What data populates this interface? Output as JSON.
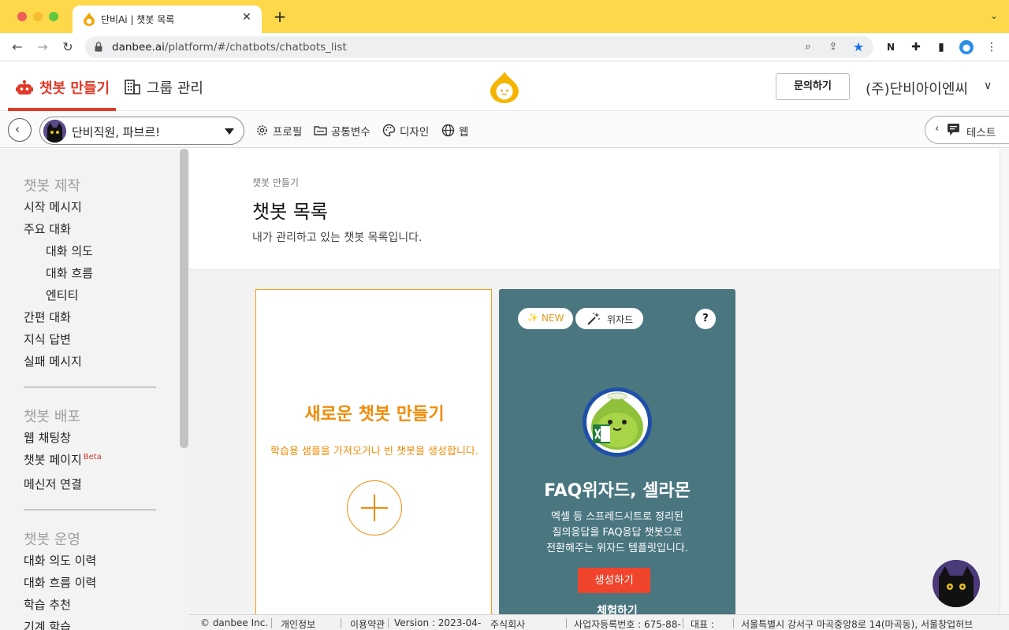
{
  "browser": {
    "tab_title": "단비Ai | 챗봇 목록",
    "url_host": "danbee.ai",
    "url_path": "/platform/#/chatbots/chatbots_list"
  },
  "header": {
    "nav_build": "챗봇 만들기",
    "nav_group": "그룹 관리",
    "inquiry_label": "문의하기",
    "company": "(주)단비아이엔씨"
  },
  "toolbar": {
    "bot_name": "단비직원, 파브르!",
    "profile": "프로필",
    "variables": "공통변수",
    "design": "디자인",
    "web": "웹",
    "test": "테스트"
  },
  "sidebar": {
    "sections": [
      {
        "title": "챗봇 제작",
        "items": [
          "시작 메시지",
          "주요 대화",
          "대화 의도",
          "대화 흐름",
          "엔티티",
          "간편 대화",
          "지식 답변",
          "실패 메시지"
        ]
      },
      {
        "title": "챗봇 배포",
        "items": [
          "웹 채팅창",
          "챗봇 페이지",
          "메신저 연결"
        ],
        "beta": "Beta"
      },
      {
        "title": "챗봇 운영",
        "items": [
          "대화 의도 이력",
          "대화 흐름 이력",
          "학습 추천",
          "기계 학습"
        ]
      }
    ]
  },
  "page": {
    "breadcrumb": "챗봇 만들기",
    "title": "챗봇 목록",
    "description": "내가 관리하고 있는 챗봇 목록입니다."
  },
  "new_card": {
    "title": "새로운 챗봇 만들기",
    "description": "학습용 샘플을 가져오거나 빈 챗봇을 생성합니다."
  },
  "faq_card": {
    "badge_new": "NEW",
    "badge_wizard": "위자드",
    "help": "?",
    "title": "FAQ위자드, 셀라몬",
    "desc_line1": "엑셀 등 스프레드시트로 정리된",
    "desc_line2": "질의응답을 FAQ응답 챗봇으로",
    "desc_line3": "전환해주는 위자드 템플릿입니다.",
    "create_label": "생성하기",
    "trial_label": "체험하기"
  },
  "footer": {
    "copyright": "© danbee Inc.",
    "privacy": "개인정보",
    "terms": "이용약관",
    "version": "Version : 2023-04-",
    "corp": "주식회사",
    "bizno": "사업자등록번호 : 675-88-",
    "ceo": "대표 :",
    "address": "서울특별시 강서구 마곡중앙8로 14(마곡동), 서울창업허브"
  },
  "colors": {
    "brand_red": "#e03a2a",
    "brand_orange": "#f08c0a",
    "faq_card_bg": "#4a7680",
    "create_btn": "#f0442c",
    "chrome_tab_bg": "#fcd84a"
  }
}
